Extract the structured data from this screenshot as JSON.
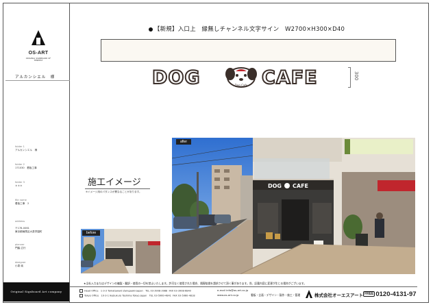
{
  "sidebar": {
    "logo_text": "OS-ART",
    "logo_sub": "ORIGINAL SIGNBOARD OF TEMPEST",
    "client_name": "アルカンシエル　様",
    "meta": [
      {
        "label": "folder 1",
        "value": "アルカンシエル　様"
      },
      {
        "label": "folder 2",
        "value": "171030　看板工事"
      },
      {
        "label": "folder 3",
        "value": "＊＊＊"
      },
      {
        "label": "file name",
        "value": "看板工事　2"
      },
      {
        "label": "address",
        "value": "〒178-0061\n東京都練馬区大泉学園町"
      },
      {
        "label": "planner",
        "value": "門脇 広行"
      },
      {
        "label": "designer",
        "value": "小泉 純"
      }
    ],
    "brand_bar": "Original Signboard Art company"
  },
  "header": {
    "title": "【新規】入口上　縁無しチャンネル文字サイン　W2700×H300×D40"
  },
  "sign": {
    "left_word": "DOG",
    "right_word": "CAFE",
    "mascot_label": "Dog Cafe",
    "dimension": "300"
  },
  "construction": {
    "heading": "施工イメージ",
    "note": "※イメージ用のパタンスが異なることがあります。"
  },
  "photos": {
    "after_label": "after",
    "before_label": "before",
    "shop_sign_left": "DOG",
    "shop_sign_right": "CAFE"
  },
  "footer": {
    "note": "★当社入力またはデザインの複製・翻訳・使用の一切を禁止いたします。許可なく使用された場合、損害賠償を請求させて頂く事があります。尚、記載内容に変更が生じる場合がございます。",
    "offices": [
      {
        "name": "Head Office",
        "address": "1-3-3 Tomatoward Zaingaokii Japan",
        "tel": "TEL 03-3908-3988",
        "fax": "FAX 03-3908-6840"
      },
      {
        "name": "Tokyo Office",
        "address": "10-3-1 Ikebukuro Toshima Tokyo Japan",
        "tel": "TEL 03-5960-4841",
        "fax": "FAX 03-5960-4818"
      }
    ],
    "email": "e-mail  info@os-art.co.jp",
    "web": "www.os-art.co.jp",
    "services": "看板・企画・デザイン・製作・施工・管理",
    "company": "株式会社オーエスアート",
    "tel_free": "FREE",
    "tel": "0120-4131-97"
  },
  "colors": {
    "sign_outline": "#3b2f2a",
    "panel_fill": "#fbf8f2",
    "brand_bar": "#111111",
    "sky": "#3d7fd6",
    "awning": "#c0262d"
  }
}
